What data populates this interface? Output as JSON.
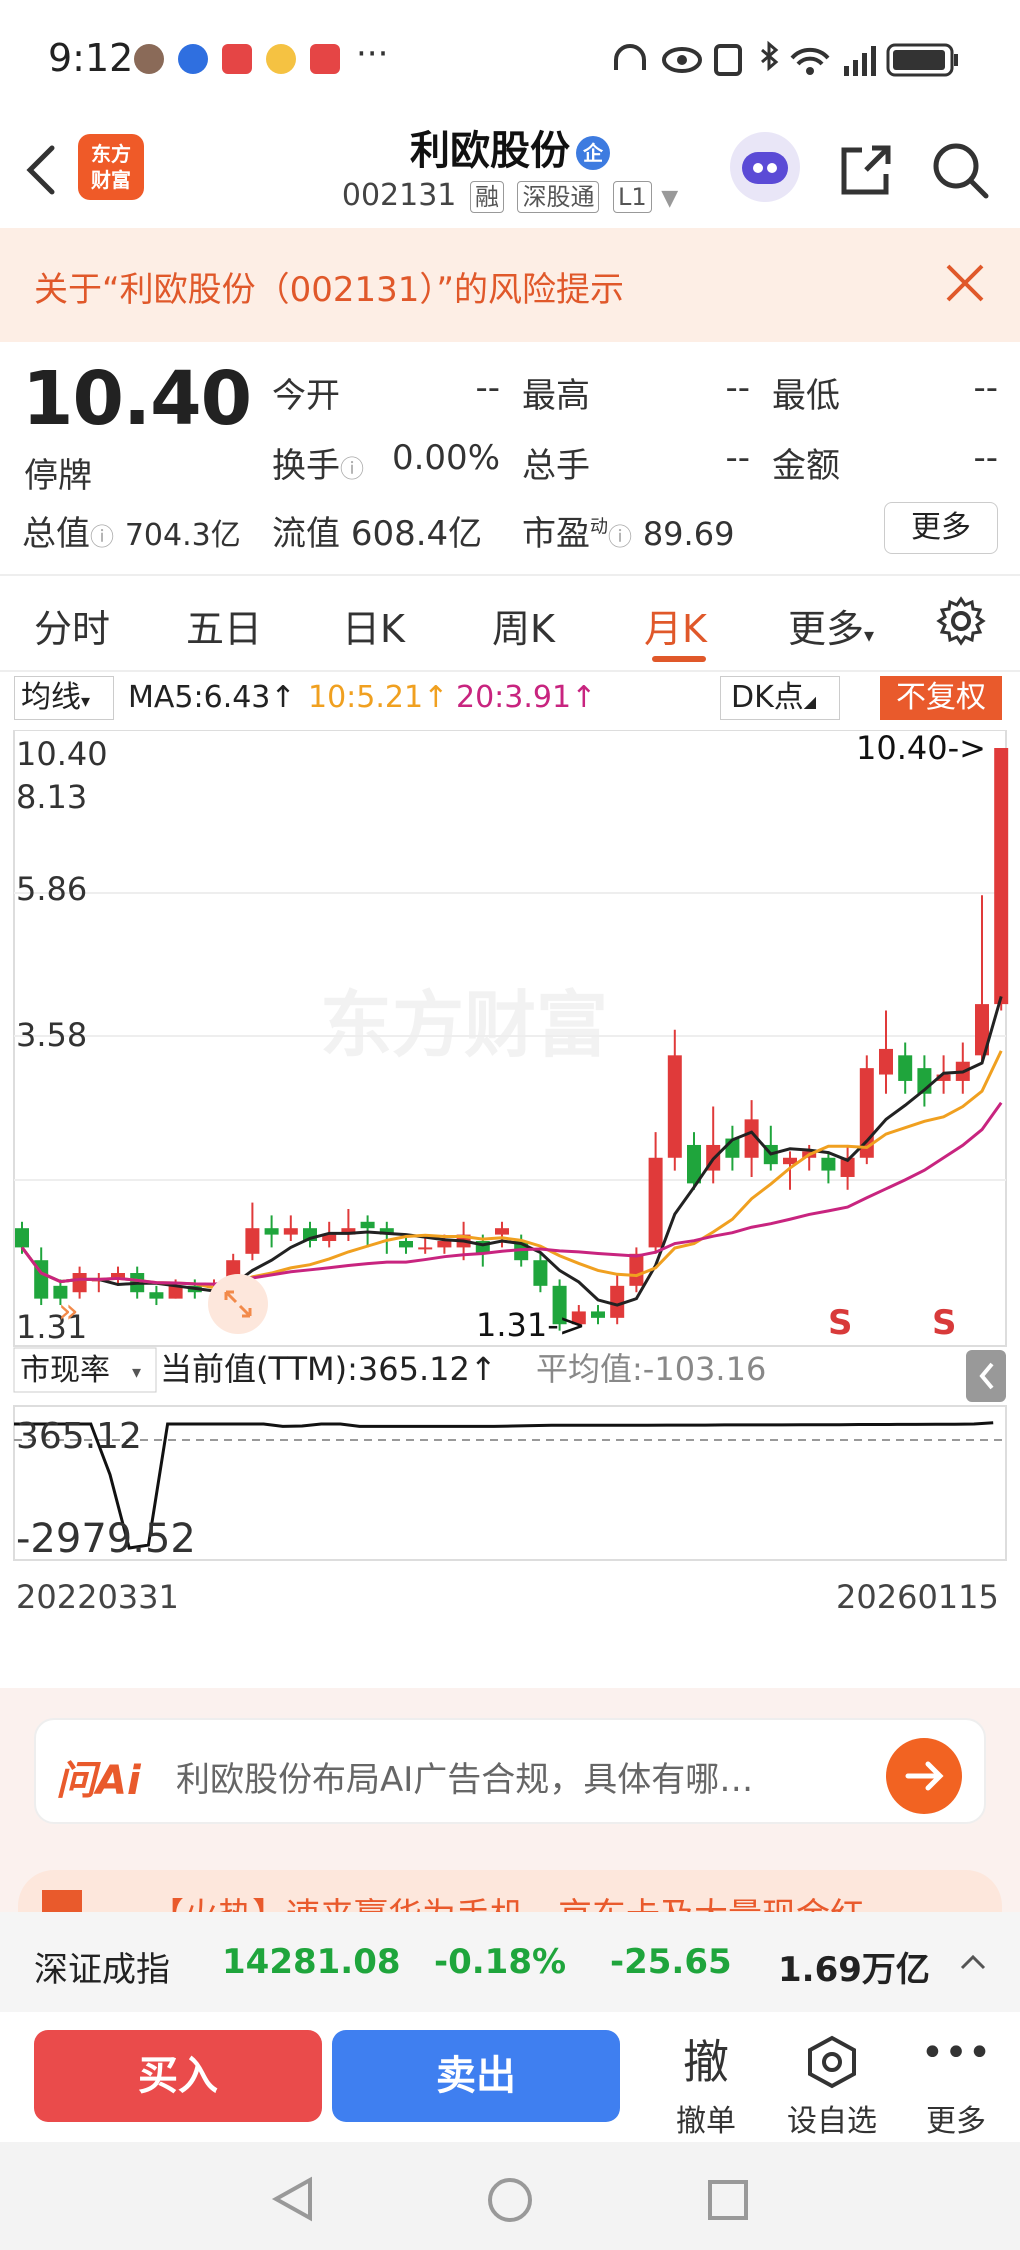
{
  "status": {
    "time": "9:12",
    "icons": [
      "avatar-icon",
      "baidu-icon",
      "app-icon",
      "weibo-icon",
      "app-icon",
      "more-dots"
    ],
    "right_icons": [
      "headphones-icon",
      "eye-icon",
      "nfc-icon",
      "bluetooth-icon",
      "wifi-icon",
      "signal-icon",
      "battery-icon"
    ]
  },
  "header": {
    "logo_line1": "东方",
    "logo_line2": "财富",
    "title": "利欧股份",
    "title_badge": "企",
    "code": "002131",
    "tags": [
      "融",
      "深股通",
      "L1"
    ]
  },
  "risk": {
    "text": "关于“利欧股份（002131）”的风险提示"
  },
  "quote": {
    "price": "10.40",
    "status": "停牌",
    "fields": [
      {
        "label": "今开",
        "value": "--"
      },
      {
        "label": "最高",
        "value": "--"
      },
      {
        "label": "最低",
        "value": "--"
      },
      {
        "label": "换手",
        "value": "0.00%"
      },
      {
        "label": "总手",
        "value": "--"
      },
      {
        "label": "金额",
        "value": "--"
      }
    ],
    "zongzhi_label": "总值",
    "zongzhi_value": "704.3亿",
    "liuzhi_label": "流值",
    "liuzhi_value": "608.4亿",
    "shiying_label": "市盈",
    "shiying_sup": "动",
    "shiying_value": "89.69",
    "more": "更多"
  },
  "tabs": [
    "分时",
    "五日",
    "日K",
    "周K",
    "月K",
    "更多"
  ],
  "active_tab": "月K",
  "ma": {
    "select": "均线",
    "ma5": "MA5:6.43↑",
    "ma10": "10:5.21↑",
    "ma20": "20:3.91↑",
    "dk": "DK点",
    "fuquan": "不复权",
    "colors": {
      "ma5": "#222222",
      "ma10": "#f0a020",
      "ma20": "#c8247f",
      "up": "#e03a3a",
      "down": "#1fa53c",
      "accent": "#e95a2c"
    }
  },
  "kchart": {
    "ticks": [
      "10.40",
      "8.13",
      "5.86",
      "3.58",
      "1.31"
    ],
    "high_marker": "10.40->",
    "low_marker": "1.31->",
    "s_marks": [
      "S",
      "S"
    ],
    "watermark": "东方财富"
  },
  "indicator": {
    "select": "市现率",
    "current": "当前值(TTM):365.12↑",
    "average": "平均值:-103.16",
    "top": "365.12",
    "bottom": "-2979.52",
    "date_start": "20220331",
    "date_end": "20260115"
  },
  "ai": {
    "logo": "问Ai",
    "text": "利欧股份布局AI广告合规，具体有哪…"
  },
  "hot": {
    "text": "【火热】速来赢华为手机、京东卡及大量现金红"
  },
  "index": {
    "name": "深证成指",
    "value": "14281.08",
    "pct": "-0.18%",
    "chg": "-25.65",
    "amount": "1.69万亿"
  },
  "actions": {
    "buy": "买入",
    "sell": "卖出",
    "cancel_icon": "撤",
    "cancel": "撤单",
    "watch": "设自选",
    "more": "更多"
  }
}
